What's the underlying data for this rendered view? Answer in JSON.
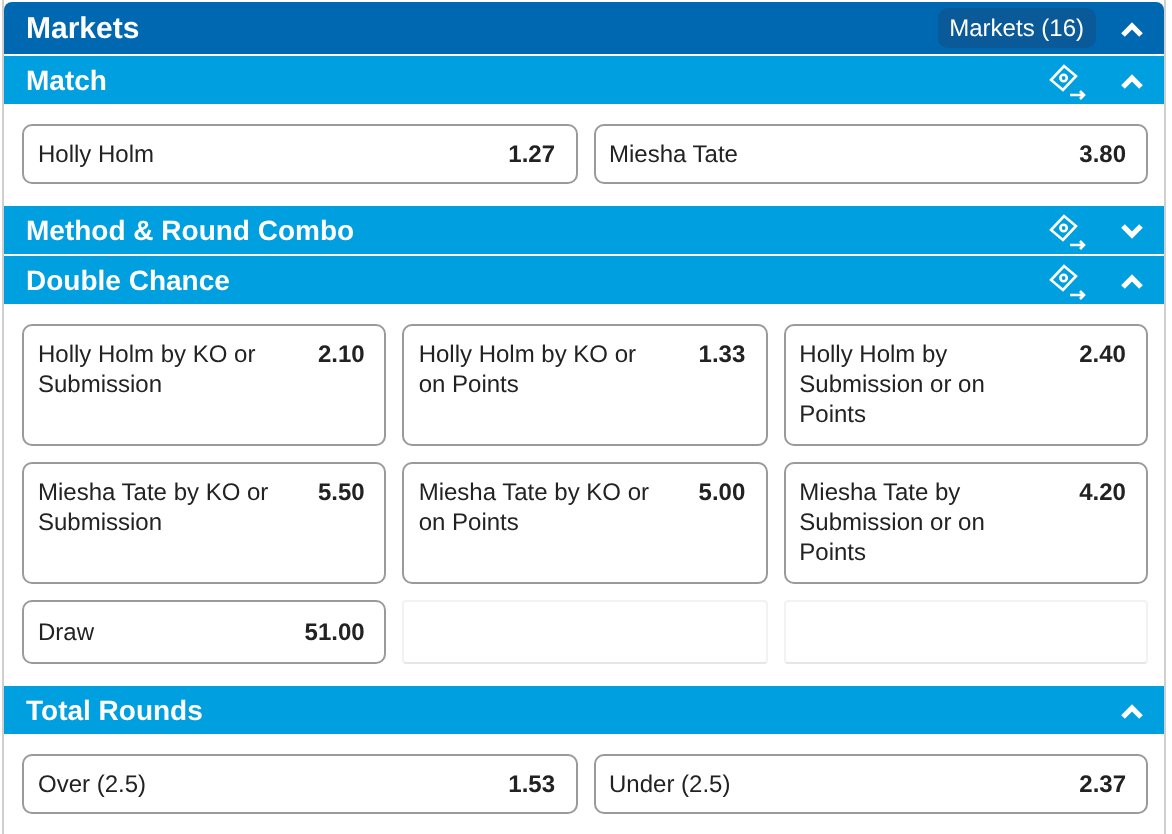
{
  "header": {
    "title": "Markets",
    "count_badge": "Markets (16)",
    "expanded": true
  },
  "sections": [
    {
      "title": "Match",
      "expanded": true,
      "bet_icon": true,
      "kind": "pair",
      "selections": [
        {
          "label": "Holly Holm",
          "odds": "1.27"
        },
        {
          "label": "Miesha Tate",
          "odds": "3.80"
        }
      ]
    },
    {
      "title": "Method & Round Combo",
      "expanded": false,
      "bet_icon": true,
      "kind": "pair"
    },
    {
      "title": "Double Chance",
      "expanded": true,
      "bet_icon": true,
      "kind": "triple",
      "selections": [
        {
          "label": "Holly Holm by KO or Submission",
          "odds": "2.10"
        },
        {
          "label": "Holly Holm by KO or on Points",
          "odds": "1.33"
        },
        {
          "label": "Holly Holm by Submission or on Points",
          "odds": "2.40"
        },
        {
          "label": "Miesha Tate by KO or Submission",
          "odds": "5.50"
        },
        {
          "label": "Miesha Tate by KO or on Points",
          "odds": "5.00"
        },
        {
          "label": "Miesha Tate by Submission or on Points",
          "odds": "4.20"
        },
        {
          "label": "Draw",
          "odds": "51.00"
        }
      ]
    },
    {
      "title": "Total Rounds",
      "expanded": true,
      "bet_icon": false,
      "kind": "pair",
      "selections": [
        {
          "label": "Over (2.5)",
          "odds": "1.53"
        },
        {
          "label": "Under (2.5)",
          "odds": "2.37"
        }
      ]
    }
  ]
}
